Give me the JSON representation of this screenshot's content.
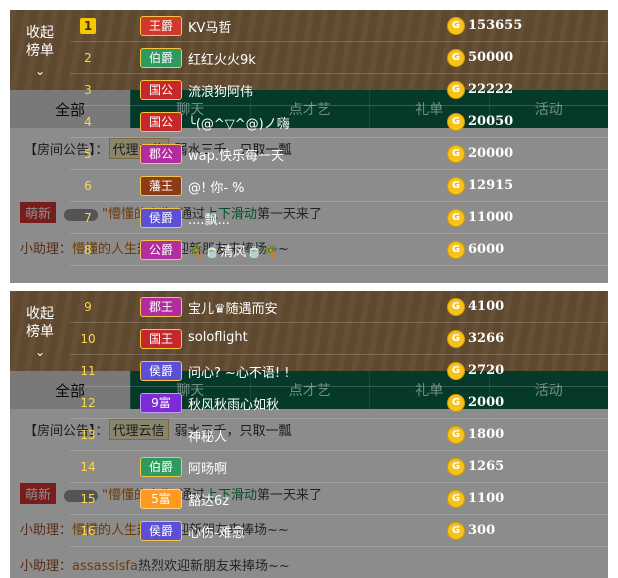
{
  "side": {
    "collapse_label_1": "收起",
    "collapse_label_2": "榜单",
    "chevron": "⌄"
  },
  "background": {
    "all_tab": "全部",
    "tabs": [
      "聊天",
      "点才艺",
      "礼单",
      "活动"
    ],
    "announce_label": "【房间公告】：",
    "announce_tag": "代理云信",
    "announce_text": "弱水三千，只取一瓢",
    "chat1_badge": "萌新",
    "chat1_name": "\"懵懂的人生\"",
    "chat1_mid": "通过",
    "chat1_hl": "上下滑动",
    "chat1_end": "第一天来了",
    "chat2_prefix": "小助理：",
    "chat2_name": "懵懂的人生",
    "chat2_text": "热烈欢迎新朋友来捧场~~",
    "chat3_prefix": "小助理：",
    "chat3_name": "assassisfa",
    "chat3_text": "热烈欢迎新朋友来捧场~~"
  },
  "coin_icon": "coin-icon",
  "panel1": [
    {
      "rank": "1",
      "title": "王爵",
      "style": "t-wang",
      "name": "KV马哲",
      "score": "153655"
    },
    {
      "rank": "2",
      "title": "伯爵",
      "style": "t-bo",
      "name": "红红火火9k",
      "score": "50000"
    },
    {
      "rank": "3",
      "title": "国公",
      "style": "t-gong",
      "name": "流浪狗阿伟",
      "score": "22222"
    },
    {
      "rank": "4",
      "title": "国公",
      "style": "t-gong",
      "name": "╰(@^▽^@)ノ嗨",
      "score": "20050"
    },
    {
      "rank": "5",
      "title": "郡公",
      "style": "t-jun",
      "name": "wap.快乐每一天",
      "score": "20000"
    },
    {
      "rank": "6",
      "title": "藩王",
      "style": "t-fan",
      "name": "@! 你- %",
      "score": "12915"
    },
    {
      "rank": "7",
      "title": "侯爵",
      "style": "t-hou",
      "name": "....飘...",
      "score": "11000"
    },
    {
      "rank": "8",
      "title": "公爵",
      "style": "t-gongjue",
      "name": "🌴🍵清风🍵🌴",
      "score": "6000"
    }
  ],
  "panel2": [
    {
      "rank": "9",
      "title": "郡王",
      "style": "t-jun",
      "name": "宝儿♛随遇而安",
      "score": "4100"
    },
    {
      "rank": "10",
      "title": "国王",
      "style": "t-gong",
      "name": "soloflight",
      "score": "3266"
    },
    {
      "rank": "11",
      "title": "侯爵",
      "style": "t-hou",
      "name": "问心? ~心不语! !",
      "score": "2720"
    },
    {
      "rank": "12",
      "title": "9富",
      "style": "t-fu",
      "name": "秋风秋雨心如秋",
      "score": "2000"
    },
    {
      "rank": "13",
      "title": "",
      "style": "t-none",
      "name": "神秘人",
      "score": "1800"
    },
    {
      "rank": "14",
      "title": "伯爵",
      "style": "t-bo",
      "name": "阿旸啊",
      "score": "1265"
    },
    {
      "rank": "15",
      "title": "5富",
      "style": "t-fu5",
      "name": "豁达6z",
      "score": "1100"
    },
    {
      "rank": "16",
      "title": "侯爵",
      "style": "t-hou",
      "name": "心伤-难愈",
      "score": "300"
    }
  ]
}
